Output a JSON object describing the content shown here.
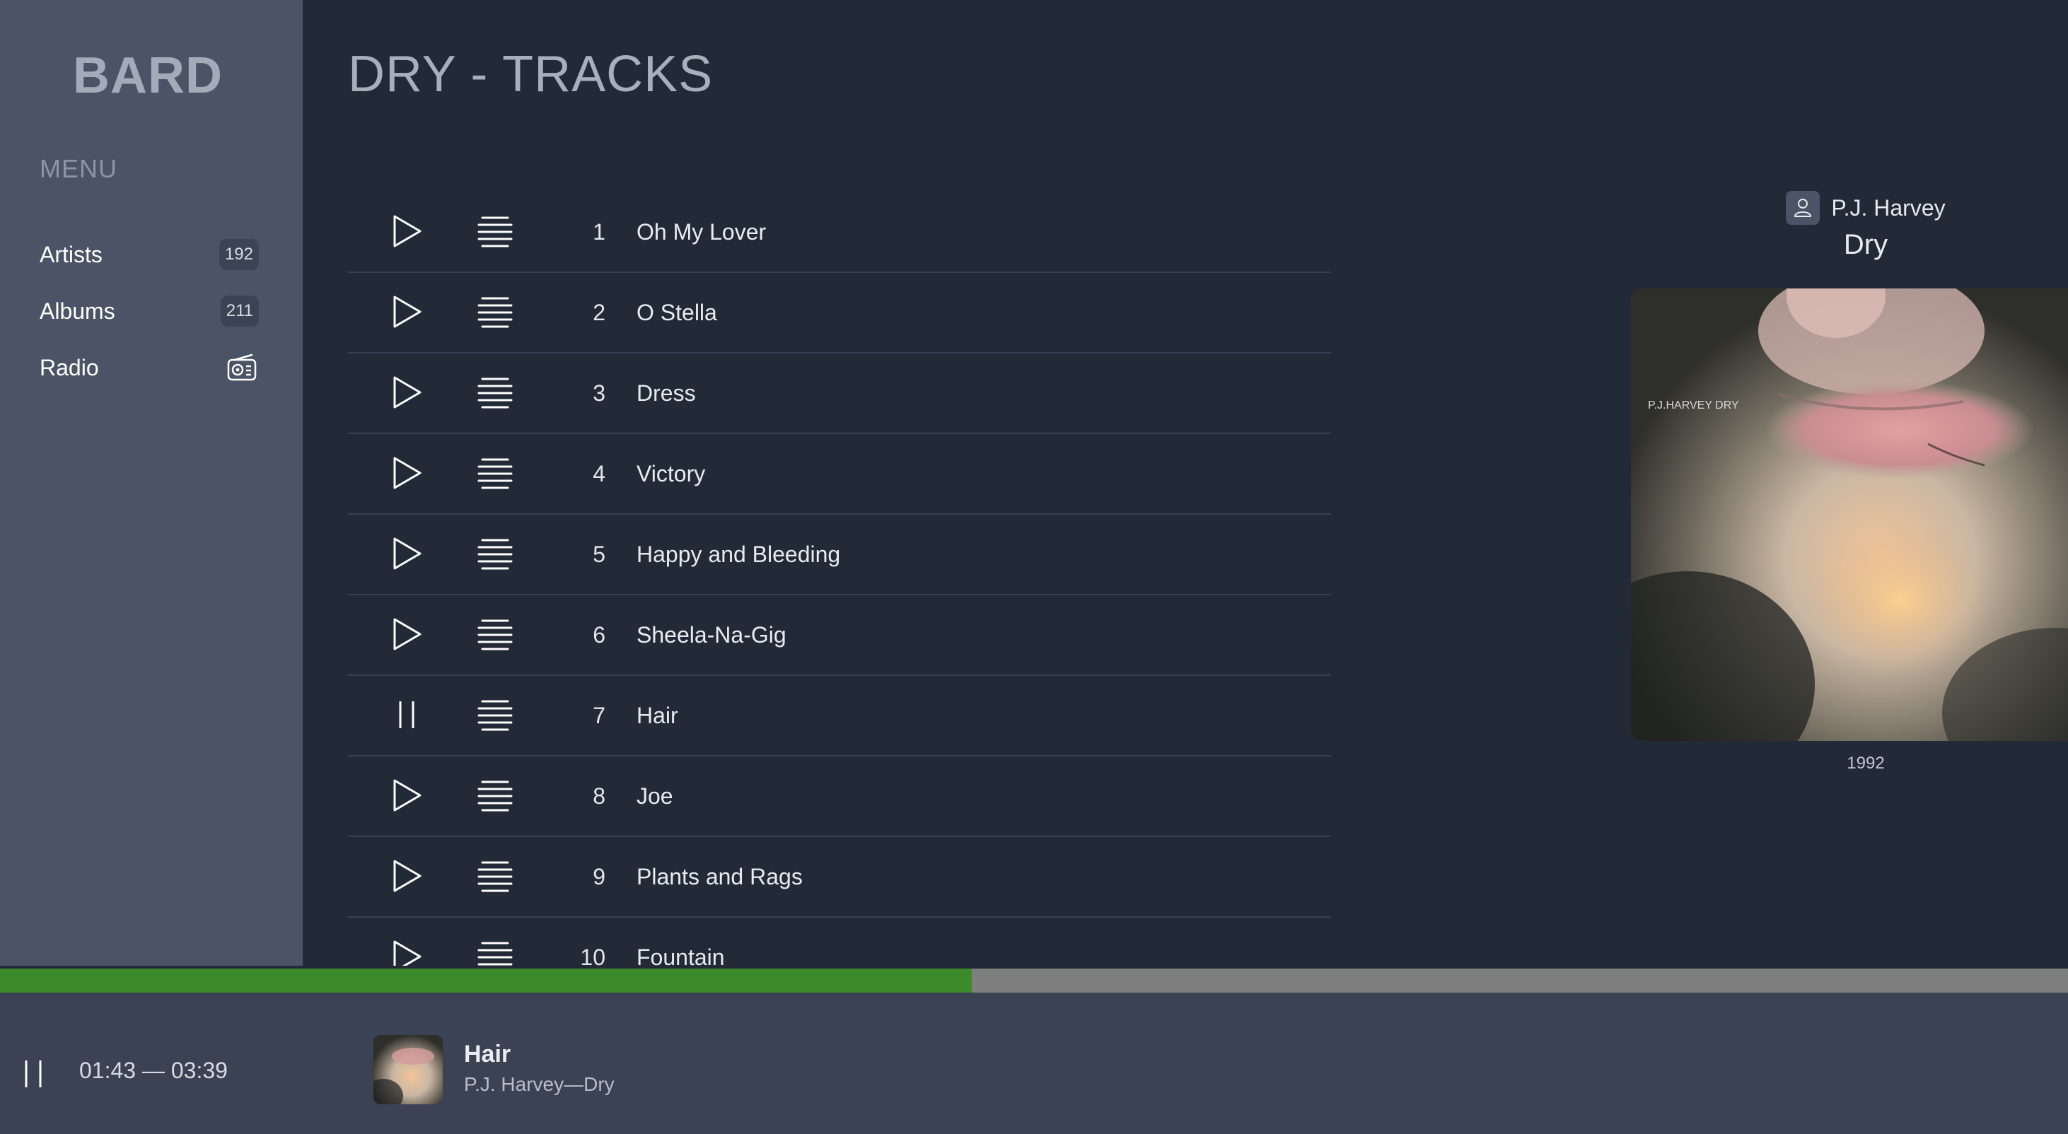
{
  "app": {
    "name": "BARD"
  },
  "sidebar": {
    "menu_title": "MENU",
    "items": [
      {
        "label": "Artists",
        "badge": "192"
      },
      {
        "label": "Albums",
        "badge": "211"
      },
      {
        "label": "Radio",
        "icon": "radio-icon"
      }
    ]
  },
  "page": {
    "title": "DRY - TRACKS"
  },
  "tracks": [
    {
      "number": "1",
      "title": "Oh My Lover",
      "state": "play"
    },
    {
      "number": "2",
      "title": "O Stella",
      "state": "play"
    },
    {
      "number": "3",
      "title": "Dress",
      "state": "play"
    },
    {
      "number": "4",
      "title": "Victory",
      "state": "play"
    },
    {
      "number": "5",
      "title": "Happy and Bleeding",
      "state": "play"
    },
    {
      "number": "6",
      "title": "Sheela-Na-Gig",
      "state": "play"
    },
    {
      "number": "7",
      "title": "Hair",
      "state": "pause"
    },
    {
      "number": "8",
      "title": "Joe",
      "state": "play"
    },
    {
      "number": "9",
      "title": "Plants and Rags",
      "state": "play"
    },
    {
      "number": "10",
      "title": "Fountain",
      "state": "play"
    }
  ],
  "album": {
    "artist": "P.J. Harvey",
    "title": "Dry",
    "year": "1992",
    "cover_text": "P.J.HARVEY  DRY"
  },
  "player": {
    "time": "01:43 — 03:39",
    "progress": 0.47,
    "track_title": "Hair",
    "track_subtitle": "P.J. Harvey—Dry"
  },
  "colors": {
    "accent_progress": "#3c8a2a",
    "sidebar_bg": "#4a5466",
    "main_bg": "#222a38",
    "player_bg": "#3a4253"
  }
}
